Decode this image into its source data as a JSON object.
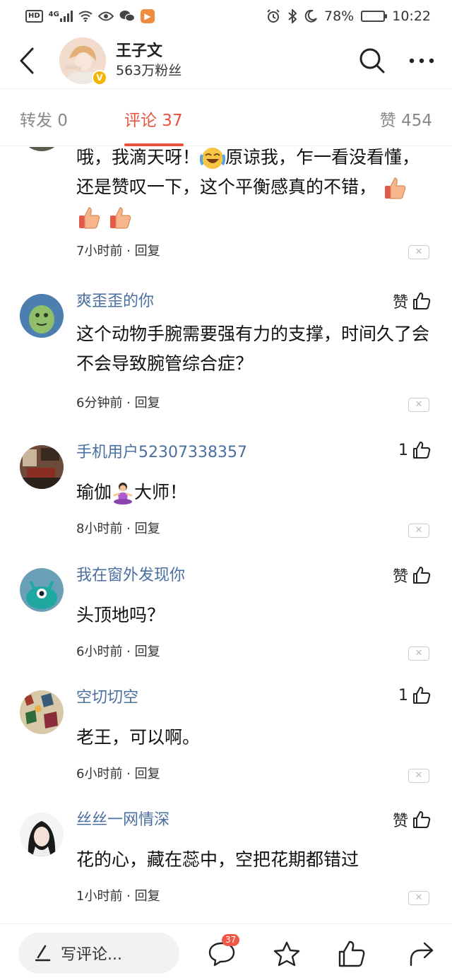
{
  "status_bar": {
    "hd": "HD",
    "network": "4G",
    "battery_percent": "78%",
    "battery_level": 0.78,
    "time": "10:22"
  },
  "header": {
    "user_name": "王子文",
    "fans": "563万粉丝",
    "verified_badge": "V"
  },
  "tabs": {
    "repost": "转发 0",
    "comment": "评论 37",
    "like": "赞 454"
  },
  "comments": [
    {
      "text_part1": "哦，我滴天呀！",
      "text_part2": "原谅我，乍一看没看懂，还是赞叹一下，这个平衡感真的不错，",
      "emoji_count": 3,
      "meta": "7小时前 · 回复",
      "close": "✕"
    },
    {
      "name": "爽歪歪的你",
      "like": "赞",
      "text": "这个动物手腕需要强有力的支撑，时间久了会不会导致腕管综合症？",
      "meta": "6分钟前 · 回复",
      "close": "✕"
    },
    {
      "name": "手机用户52307338357",
      "like": "1",
      "text_part1": "瑜伽",
      "text_part2": "大师！",
      "meta": "8小时前 · 回复",
      "close": "✕"
    },
    {
      "name": "我在窗外发现你",
      "like": "赞",
      "text": "头顶地吗？",
      "meta": "6小时前 · 回复",
      "close": "✕"
    },
    {
      "name": "空切切空",
      "like": "1",
      "text": "老王，可以啊。",
      "meta": "6小时前 · 回复",
      "close": "✕"
    },
    {
      "name": "丝丝一网情深",
      "like": "赞",
      "text": "花的心，藏在蕊中，空把花期都错过",
      "meta": "1小时前 · 回复",
      "close": "✕"
    }
  ],
  "bottom_bar": {
    "write_placeholder": "写评论...",
    "comment_count": "37"
  },
  "colors": {
    "accent": "#e8533d",
    "link": "#4a6fa1"
  }
}
